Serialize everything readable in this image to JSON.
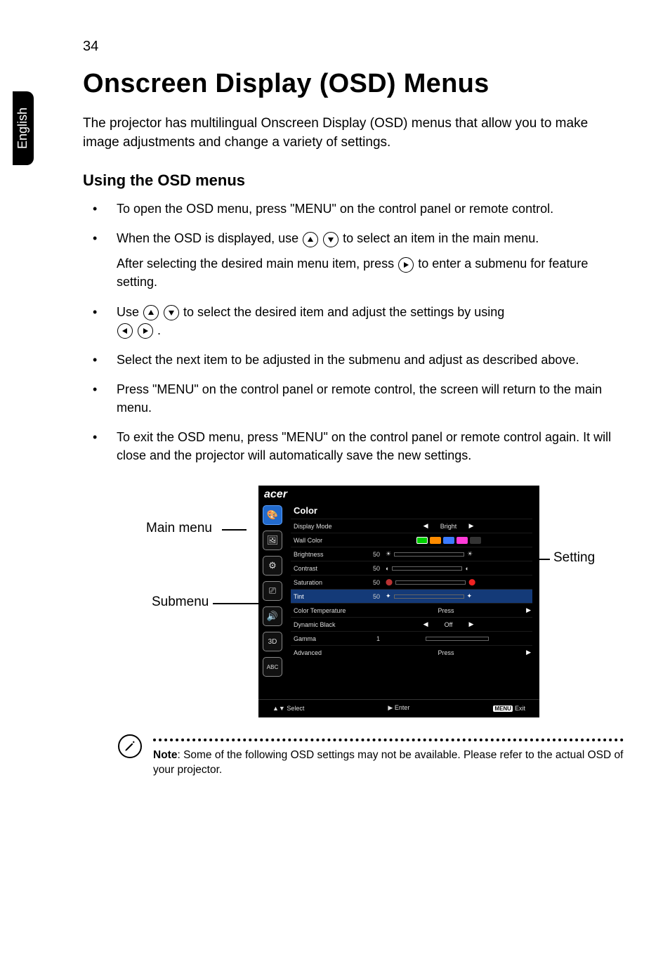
{
  "page_number": "34",
  "side_tab": "English",
  "heading": "Onscreen Display (OSD) Menus",
  "intro": "The projector has multilingual Onscreen Display (OSD) menus that allow you to make image adjustments and change a variety of settings.",
  "subheading": "Using the OSD menus",
  "bullets": {
    "b1": "To open the OSD menu, press \"MENU\" on the control panel or remote control.",
    "b2a": "When the OSD is displayed, use ",
    "b2b": " to select an item in the main menu.",
    "b2_sub_a": "After selecting the desired main menu item, press ",
    "b2_sub_b": " to enter a submenu for feature setting.",
    "b3a": "Use ",
    "b3b": " to select the desired item and adjust the settings by using ",
    "b3c": ".",
    "b4": "Select the next item to be adjusted in the submenu and adjust as described above.",
    "b5": "Press \"MENU\" on the control panel or remote control, the screen will return to the main menu.",
    "b6": "To exit the OSD menu, press \"MENU\" on the control panel or remote control again. It will close and the projector will automatically save the new settings."
  },
  "labels": {
    "main_menu": "Main menu",
    "submenu": "Submenu",
    "setting": "Setting"
  },
  "osd": {
    "brand": "acer",
    "section_title": "Color",
    "nav_icons": [
      "palette",
      "image",
      "gear",
      "mgmt",
      "audio",
      "3d",
      "lang"
    ],
    "rows": [
      {
        "label": "Display Mode",
        "type": "select",
        "value": "Bright"
      },
      {
        "label": "Wall Color",
        "type": "swatches"
      },
      {
        "label": "Brightness",
        "type": "slider",
        "num": "50"
      },
      {
        "label": "Contrast",
        "type": "slider",
        "num": "50"
      },
      {
        "label": "Saturation",
        "type": "slider",
        "num": "50"
      },
      {
        "label": "Tint",
        "type": "slider",
        "num": "50"
      },
      {
        "label": "Color Temperature",
        "type": "press",
        "value": "Press"
      },
      {
        "label": "Dynamic Black",
        "type": "select",
        "value": "Off"
      },
      {
        "label": "Gamma",
        "type": "gamma",
        "num": "1"
      },
      {
        "label": "Advanced",
        "type": "press",
        "value": "Press"
      }
    ],
    "footer": {
      "select": "Select",
      "enter": "Enter",
      "menu": "MENU",
      "exit": "Exit"
    }
  },
  "note": {
    "label": "Note",
    "text": ": Some of the following OSD settings may not be available. Please refer to the actual OSD of your projector."
  }
}
